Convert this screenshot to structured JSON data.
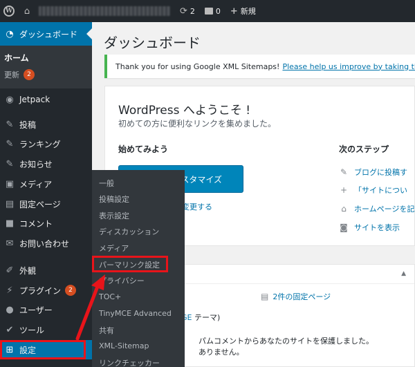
{
  "adminbar": {
    "updates_count": "2",
    "comments_count": "0",
    "new_label": "新規"
  },
  "sidebar": {
    "dashboard": "ダッシュボード",
    "home": "ホーム",
    "updates": "更新",
    "updates_badge": "2",
    "items": [
      {
        "label": "Jetpack",
        "icon": "jetpack-icon"
      },
      {
        "label": "投稿",
        "icon": "pin-icon"
      },
      {
        "label": "ランキング",
        "icon": "pin-icon"
      },
      {
        "label": "お知らせ",
        "icon": "pin-icon"
      },
      {
        "label": "メディア",
        "icon": "media-icon"
      },
      {
        "label": "固定ページ",
        "icon": "page-icon"
      },
      {
        "label": "コメント",
        "icon": "comment-icon"
      },
      {
        "label": "お問い合わせ",
        "icon": "mail-icon"
      },
      {
        "label": "外観",
        "icon": "brush-icon"
      },
      {
        "label": "プラグイン",
        "icon": "plugin-icon",
        "badge": "2"
      },
      {
        "label": "ユーザー",
        "icon": "user-icon"
      },
      {
        "label": "ツール",
        "icon": "wrench-icon"
      },
      {
        "label": "設定",
        "icon": "settings-icon"
      }
    ]
  },
  "flyout": {
    "items": [
      "一般",
      "投稿設定",
      "表示設定",
      "ディスカッション",
      "メディア",
      "パーマリンク設定",
      "プライバシー",
      "TOC+",
      "TinyMCE Advanced",
      "共有",
      "XML-Sitemap",
      "リンクチェッカー"
    ]
  },
  "main": {
    "title": "ダッシュボード",
    "notice": {
      "text": "Thank you for using Google XML Sitemaps!",
      "link": "Please help us improve by taking this short"
    },
    "welcome": {
      "heading": "WordPress へようこそ !",
      "subtitle": "初めての方に便利なリンクを集めました。",
      "get_started": "始めてみよう",
      "next_steps": "次のステップ",
      "cta_button": "スタマイズ",
      "theme_link": "に変更する",
      "steps": [
        {
          "label": "ブログに投稿す",
          "icon": "edit-icon"
        },
        {
          "label": "「サイトについ",
          "icon": "plus-icon"
        },
        {
          "label": "ホームページを記",
          "icon": "home-icon"
        },
        {
          "label": "サイトを表示",
          "icon": "view-icon"
        }
      ]
    },
    "glance": {
      "pages": "2件の固定ページ",
      "theme_link": "GE",
      "theme_suffix": " テーマ)",
      "spam_line1": "パムコメントからあなたのサイトを保護しました。",
      "spam_line2": "ありません。"
    }
  },
  "colors": {
    "accent": "#0073aa",
    "sidebar_bg": "#23282d",
    "highlight": "#e8141a",
    "notice_border": "#46b450",
    "badge": "#d54e21"
  }
}
